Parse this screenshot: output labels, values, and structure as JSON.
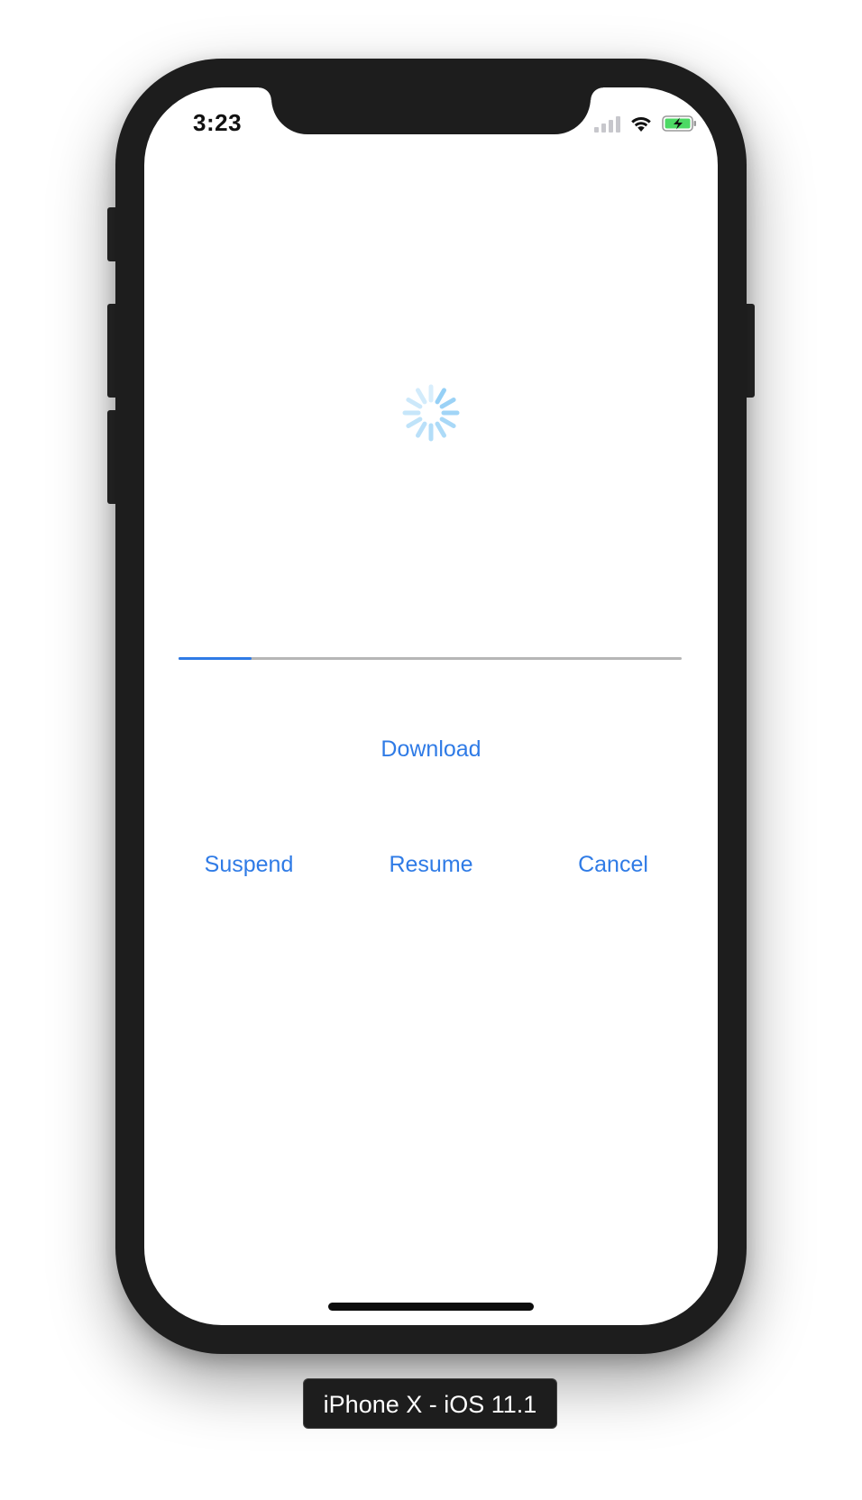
{
  "status_bar": {
    "time": "3:23",
    "icons": [
      "signal-bars-icon",
      "wifi-icon",
      "battery-charging-icon"
    ]
  },
  "activity_indicator": {
    "icon": "spinner-icon",
    "color": "#8fcdf5"
  },
  "progress": {
    "value": 0.145,
    "fill_color": "#2f7be6",
    "track_color": "#b6b6b6"
  },
  "buttons": {
    "download": "Download",
    "suspend": "Suspend",
    "resume": "Resume",
    "cancel": "Cancel"
  },
  "accent_color": "#2f7be6",
  "device_caption": "iPhone X - iOS 11.1"
}
